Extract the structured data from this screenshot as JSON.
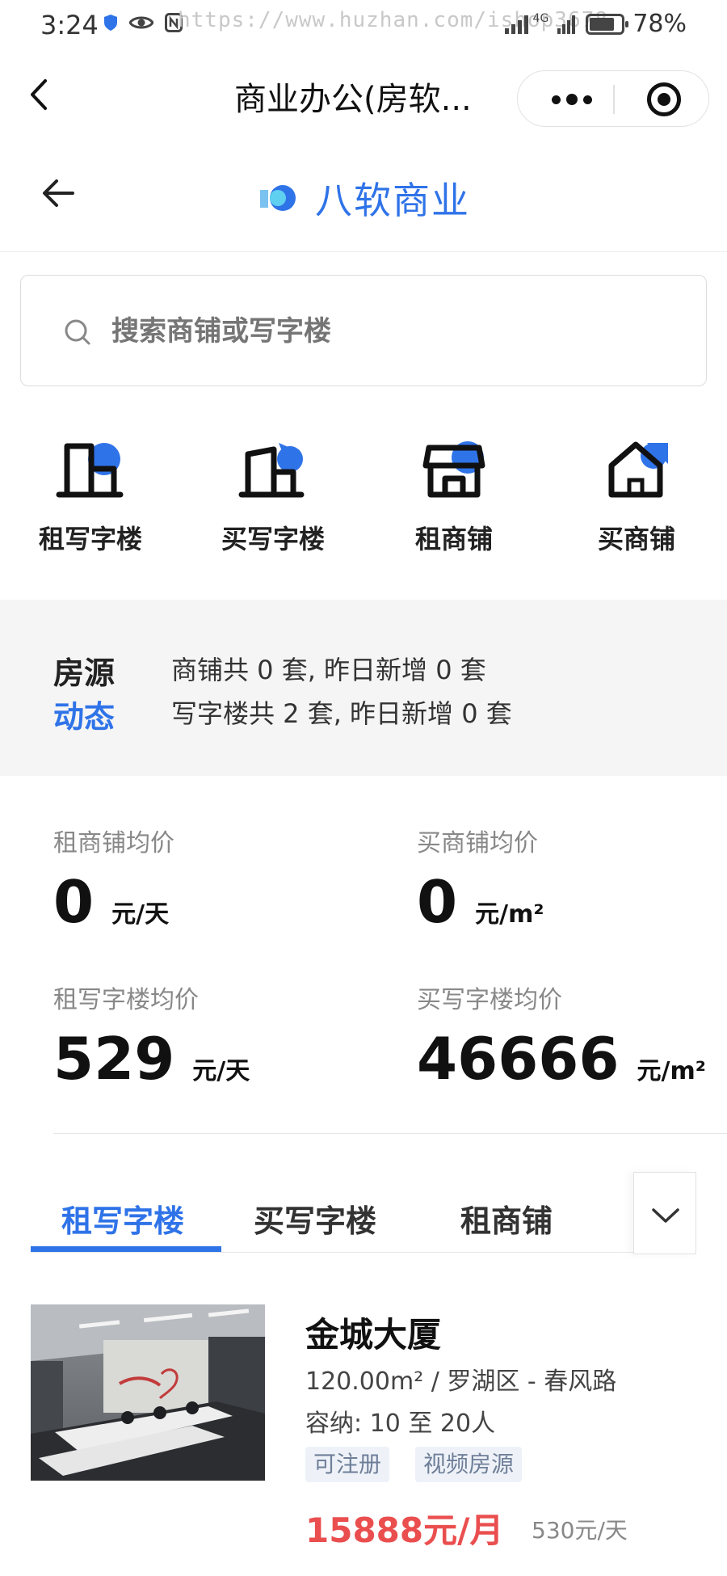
{
  "status_bar": {
    "time": "3:24",
    "watermark": "https://www.huzhan.com/ishop3678",
    "signal": "4G",
    "battery": "78%",
    "battery_level": 0.78
  },
  "mini_program": {
    "title": "商业办公(房软...",
    "more_icon": "more-dots-icon",
    "close_icon": "target-close-icon"
  },
  "app_header": {
    "brand": "八软商业"
  },
  "search": {
    "placeholder": "搜索商铺或写字楼"
  },
  "categories": [
    {
      "label": "租写字楼",
      "icon": "office-rent-icon"
    },
    {
      "label": "买写字楼",
      "icon": "office-buy-icon"
    },
    {
      "label": "租商铺",
      "icon": "shop-rent-icon"
    },
    {
      "label": "买商铺",
      "icon": "shop-buy-icon"
    }
  ],
  "stats_banner": {
    "title_line1": "房源",
    "title_line2": "动态",
    "lines": [
      "商铺共 0 套, 昨日新增 0 套",
      "写字楼共 2 套, 昨日新增 0 套"
    ]
  },
  "prices": [
    {
      "label": "租商铺均价",
      "value": "0",
      "unit": "元/天"
    },
    {
      "label": "买商铺均价",
      "value": "0",
      "unit": "元/m²"
    },
    {
      "label": "租写字楼均价",
      "value": "529",
      "unit": "元/天"
    },
    {
      "label": "买写字楼均价",
      "value": "46666",
      "unit": "元/m²"
    }
  ],
  "tabs": {
    "items": [
      "租写字楼",
      "买写字楼",
      "租商铺"
    ],
    "active_index": 0
  },
  "listing": {
    "title": "金城大厦",
    "info": "120.00m² / 罗湖区 - 春风路",
    "capacity": "容纳: 10 至 20人",
    "tags": [
      "可注册",
      "视频房源"
    ],
    "price": "15888元/月",
    "daily": "530元/天"
  },
  "colors": {
    "accent": "#2f73e8",
    "price_red": "#ea4e4e",
    "banner_bg": "#f5f5f5"
  }
}
